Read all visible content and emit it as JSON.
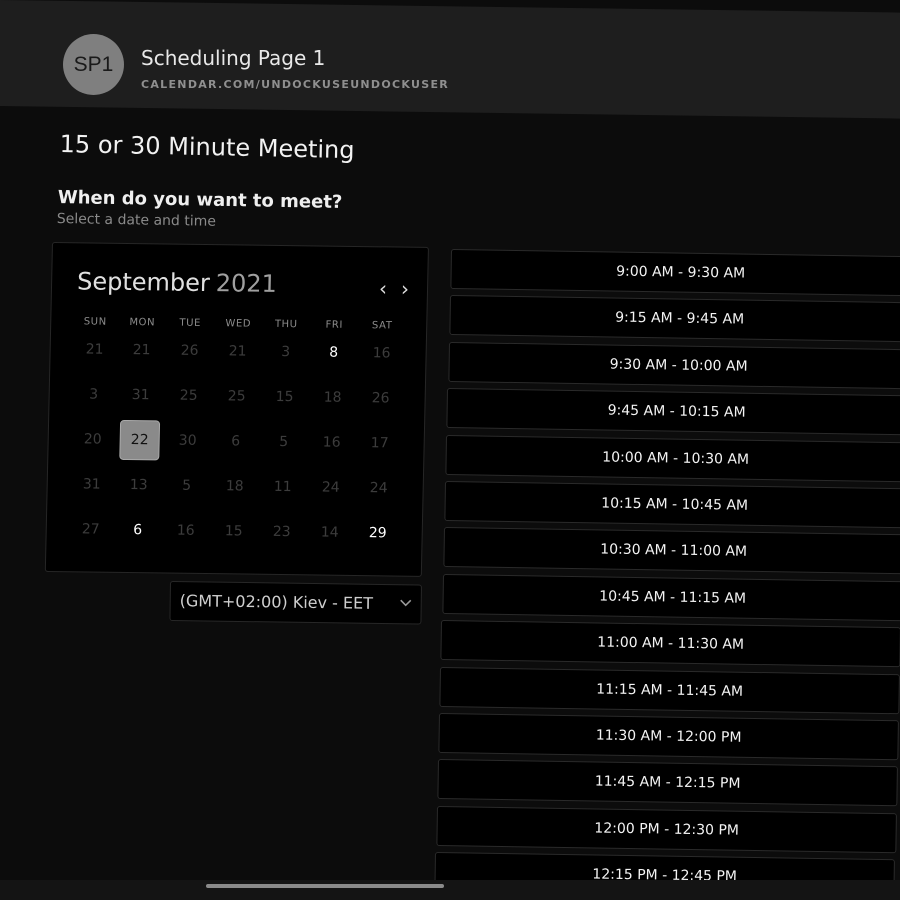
{
  "header": {
    "avatar_initials": "SP1",
    "title": "Scheduling Page 1",
    "url": "CALENDAR.COM/UNDOCKUSEUNDOCKUSER"
  },
  "meeting": {
    "title": "15 or 30 Minute Meeting",
    "question": "When do you want to meet?",
    "hint": "Select a date and time"
  },
  "calendar": {
    "month": "September",
    "year": "2021",
    "prev_icon": "chevron-left-icon",
    "next_icon": "chevron-right-icon",
    "weekdays": [
      "SUN",
      "MON",
      "TUE",
      "WED",
      "THU",
      "FRI",
      "SAT"
    ],
    "weeks": [
      [
        {
          "d": "21",
          "s": "off"
        },
        {
          "d": "21",
          "s": "off"
        },
        {
          "d": "26",
          "s": "off"
        },
        {
          "d": "21",
          "s": "off"
        },
        {
          "d": "3",
          "s": "off"
        },
        {
          "d": "8",
          "s": "avail"
        },
        {
          "d": "16",
          "s": "off"
        }
      ],
      [
        {
          "d": "3",
          "s": "off"
        },
        {
          "d": "31",
          "s": "off"
        },
        {
          "d": "25",
          "s": "off"
        },
        {
          "d": "25",
          "s": "off"
        },
        {
          "d": "15",
          "s": "off"
        },
        {
          "d": "18",
          "s": "off"
        },
        {
          "d": "26",
          "s": "off"
        }
      ],
      [
        {
          "d": "20",
          "s": "off"
        },
        {
          "d": "22",
          "s": "selected"
        },
        {
          "d": "30",
          "s": "off"
        },
        {
          "d": "6",
          "s": "off"
        },
        {
          "d": "5",
          "s": "off"
        },
        {
          "d": "16",
          "s": "off"
        },
        {
          "d": "17",
          "s": "off"
        }
      ],
      [
        {
          "d": "31",
          "s": "off"
        },
        {
          "d": "13",
          "s": "off"
        },
        {
          "d": "5",
          "s": "off"
        },
        {
          "d": "18",
          "s": "off"
        },
        {
          "d": "11",
          "s": "off"
        },
        {
          "d": "24",
          "s": "off"
        },
        {
          "d": "24",
          "s": "off"
        }
      ],
      [
        {
          "d": "27",
          "s": "off"
        },
        {
          "d": "6",
          "s": "avail"
        },
        {
          "d": "16",
          "s": "off"
        },
        {
          "d": "15",
          "s": "off"
        },
        {
          "d": "23",
          "s": "off"
        },
        {
          "d": "14",
          "s": "off"
        },
        {
          "d": "29",
          "s": "avail"
        }
      ]
    ]
  },
  "timezone": {
    "label": "(GMT+02:00) Kiev - EET",
    "icon": "chevron-down-icon"
  },
  "slots": [
    "9:00 AM - 9:30 AM",
    "9:15 AM - 9:45 AM",
    "9:30 AM - 10:00 AM",
    "9:45 AM - 10:15 AM",
    "10:00 AM - 10:30 AM",
    "10:15 AM - 10:45 AM",
    "10:30 AM - 11:00 AM",
    "10:45 AM - 11:15 AM",
    "11:00 AM - 11:30 AM",
    "11:15 AM - 11:45 AM",
    "11:30 AM - 12:00 PM",
    "11:45 AM - 12:15 PM",
    "12:00 PM - 12:30 PM",
    "12:15 PM - 12:45 PM"
  ],
  "colors": {
    "background": "#0c0c0c",
    "header": "#1e1e1e",
    "selected_day": "#8a8a8a",
    "available_day": "#ffffff",
    "unavailable_day": "#3c3c3c"
  }
}
